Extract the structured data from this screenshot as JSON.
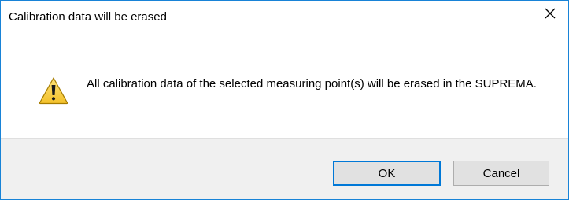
{
  "window": {
    "title": "Calibration data will be erased",
    "close_icon": "close-icon"
  },
  "message": {
    "icon": "warning-icon",
    "text": "All calibration data of the selected measuring point(s) will be erased in the SUPREMA."
  },
  "buttons": {
    "ok_label": "OK",
    "cancel_label": "Cancel"
  },
  "colors": {
    "window_border": "#1883d7",
    "footer_background": "#f0f0f0",
    "button_background": "#e1e1e1",
    "default_button_border": "#0078d7",
    "warning_yellow": "#f6cc38"
  }
}
